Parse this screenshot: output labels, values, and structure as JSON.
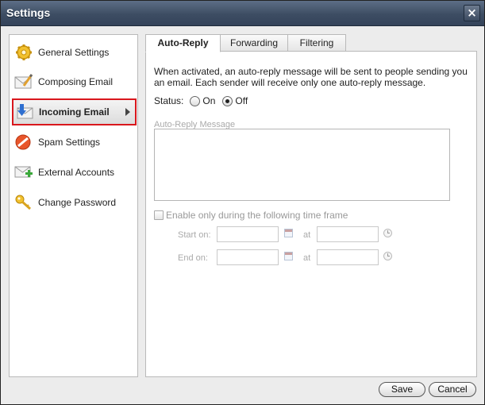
{
  "window": {
    "title": "Settings",
    "close_glyph": "×"
  },
  "sidebar": {
    "items": [
      {
        "label": "General Settings",
        "icon": "gear-icon",
        "active": false
      },
      {
        "label": "Composing Email",
        "icon": "envelope-compose-icon",
        "active": false
      },
      {
        "label": "Incoming Email",
        "icon": "inbox-download-icon",
        "active": true
      },
      {
        "label": "Spam Settings",
        "icon": "no-entry-icon",
        "active": false
      },
      {
        "label": "External Accounts",
        "icon": "envelope-add-icon",
        "active": false
      },
      {
        "label": "Change Password",
        "icon": "key-icon",
        "active": false
      }
    ],
    "active_color": "#d9171d"
  },
  "tabs": [
    {
      "label": "Auto-Reply",
      "active": true
    },
    {
      "label": "Forwarding",
      "active": false
    },
    {
      "label": "Filtering",
      "active": false
    }
  ],
  "auto_reply": {
    "description": "When activated, an auto-reply message will be sent to people sending you an email. Each sender will receive only one auto-reply message.",
    "status_label": "Status:",
    "status_on_label": "On",
    "status_off_label": "Off",
    "status_value": "Off",
    "message_label": "Auto-Reply Message",
    "message_value": "",
    "timeframe_label": "Enable only during the following time frame",
    "timeframe_enabled": false,
    "start_label": "Start on:",
    "end_label": "End on:",
    "at_label": "at"
  },
  "footer": {
    "save_label": "Save",
    "cancel_label": "Cancel"
  }
}
